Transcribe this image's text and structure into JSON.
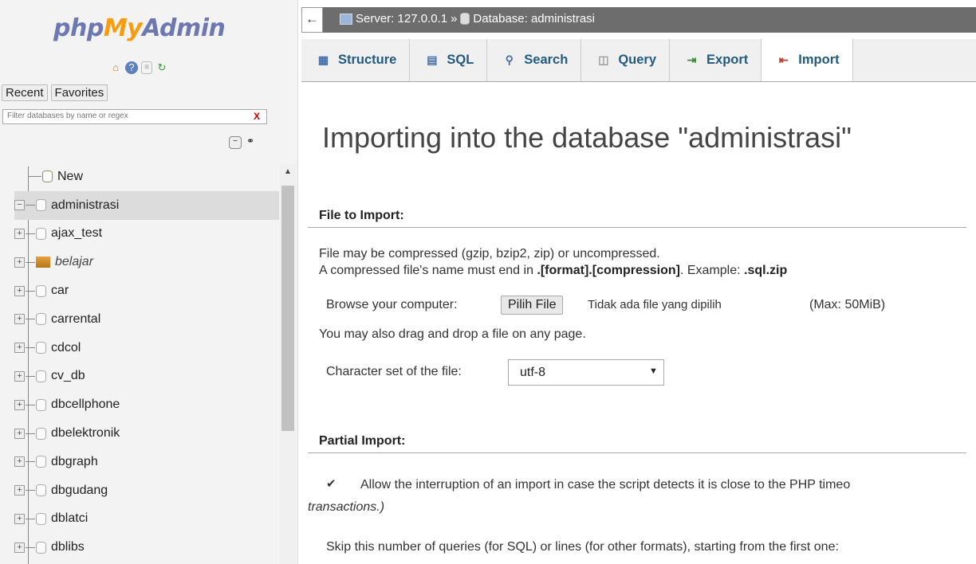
{
  "sidebar": {
    "logo": {
      "part1": "php",
      "part2": "My",
      "part3": "Admin"
    },
    "quick_icons": [
      "home-icon",
      "help-icon",
      "docs-icon",
      "reload-icon"
    ],
    "recent_label": "Recent",
    "favorites_label": "Favorites",
    "filter_placeholder": "Filter databases by name or regex",
    "filter_clear": "X",
    "new_label": "New",
    "databases": [
      {
        "name": "administrasi",
        "selected": true,
        "expanded": true
      },
      {
        "name": "ajax_test"
      },
      {
        "name": "belajar",
        "italic": true
      },
      {
        "name": "car"
      },
      {
        "name": "carrental"
      },
      {
        "name": "cdcol"
      },
      {
        "name": "cv_db"
      },
      {
        "name": "dbcellphone"
      },
      {
        "name": "dbelektronik"
      },
      {
        "name": "dbgraph"
      },
      {
        "name": "dbgudang"
      },
      {
        "name": "dblatci"
      },
      {
        "name": "dblibs"
      }
    ]
  },
  "topbar": {
    "back": "←",
    "server": "Server: 127.0.0.1",
    "sep": "»",
    "database": "Database: administrasi"
  },
  "tabs": [
    {
      "label": "Structure",
      "icon": "structure-icon"
    },
    {
      "label": "SQL",
      "icon": "sql-icon"
    },
    {
      "label": "Search",
      "icon": "search-icon"
    },
    {
      "label": "Query",
      "icon": "query-icon"
    },
    {
      "label": "Export",
      "icon": "export-icon"
    },
    {
      "label": "Import",
      "icon": "import-icon",
      "active": true
    }
  ],
  "main": {
    "title": "Importing into the database \"administrasi\"",
    "file_to_import": "File to Import:",
    "compress_line1": "File may be compressed (gzip, bzip2, zip) or uncompressed.",
    "compress_line2a": "A compressed file's name must end in ",
    "compress_line2b": ".[format].[compression]",
    "compress_line2c": ". Example: ",
    "compress_line2d": ".sql.zip",
    "browse_label": "Browse your computer:",
    "browse_button": "Pilih File",
    "no_file": "Tidak ada file yang dipilih",
    "max_size": "(Max: 50MiB)",
    "drag_drop": "You may also drag and drop a file on any page.",
    "charset_label": "Character set of the file:",
    "charset_value": "utf-8",
    "partial_import": "Partial Import:",
    "allow_interrupt": "Allow the interruption of an import in case the script detects it is close to the PHP timeo",
    "transactions": "transactions.)",
    "skip_queries": "Skip this number of queries (for SQL) or lines (for other formats), starting from the first one:"
  }
}
